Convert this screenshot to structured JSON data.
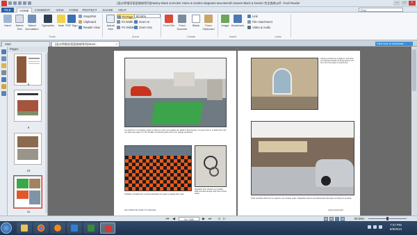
{
  "titlebar": {
    "title": "[设计师指导家居装修系列]Stanley Black & Decker Home & Garden diagrams-seventeenth season Black & Decker 完全指南.pdf - Foxit Reader"
  },
  "tabs": {
    "file": "FILE",
    "home": "HOME",
    "comment": "COMMENT",
    "view": "VIEW",
    "form": "FORM",
    "protect": "PROTECT",
    "share": "SHARE",
    "help": "HELP"
  },
  "find": {
    "placeholder": "Find"
  },
  "ribbon": {
    "hand": "Hand",
    "select_text": "Select Text",
    "select_annotation": "Select Annotation",
    "typewriter": "Typewriter",
    "note": "Note",
    "pdf_sign": "PDF Sign",
    "snapshot": "SnapShot",
    "clipboard": "Clipboard",
    "reader_view": "Reader View",
    "actual_size": "Actual Size",
    "fit_page": "Fit Page",
    "fit_width": "Fit Width",
    "fit_visible": "Fit Visible",
    "zoom_value": "60.04%",
    "zoom_in": "Zoom In",
    "zoom_out": "Zoom Out",
    "from_file": "From File",
    "from_scanner": "From Scanner",
    "blank": "Blank",
    "from_clipboard": "From Clipboard",
    "image": "Image",
    "bookmark": "Bookmark",
    "link": "Link",
    "file_attachment": "File Attachment",
    "video_audio": "Video & Audio",
    "groups": {
      "tools": "Tools",
      "zoom": "Zoom",
      "create": "Create",
      "insert": "Insert",
      "links": "Links"
    }
  },
  "doctabs": {
    "start": "Start",
    "document": "[设计师指导家居装修系列]Stanl..."
  },
  "notice": "Click here to download",
  "sidebar": {
    "header": "Pages",
    "thumbs": [
      {
        "num": "8"
      },
      {
        "num": "9"
      },
      {
        "num": "10"
      },
      {
        "num": "11"
      }
    ]
  },
  "page_left": {
    "caption1": "If a workroom or recreation space is what you need, your garage can adapt to that purpose. An epoxy floor or a rubber floor mat can help (see pages 74–75). Durable vinyl flooring also turns up in garage workshops.",
    "caption2": "Installing a durable floor covering dedicates the space to garage floor uses.",
    "caption3": "Revitalize floor. Rocket your budget: Wall-mounted storage units free up floor space.",
    "folio": "8 ■ COMPLETE GUIDE TO GARAGES"
  },
  "page_right": {
    "caption1": "Garage windows let sunlight in, and when your garage doubles as living space it can be a very nice place to spend time.",
    "caption2": "Think carefully about how to organize your storage space. Adaptable shelves and wall panels help keep everything in its place.",
    "folio": "Getting Started ■ 9"
  },
  "status": {
    "page": "11 / 341",
    "zoom": "60.04%"
  },
  "clock": {
    "time": "7:27 PM",
    "date": "6/6/2013"
  }
}
